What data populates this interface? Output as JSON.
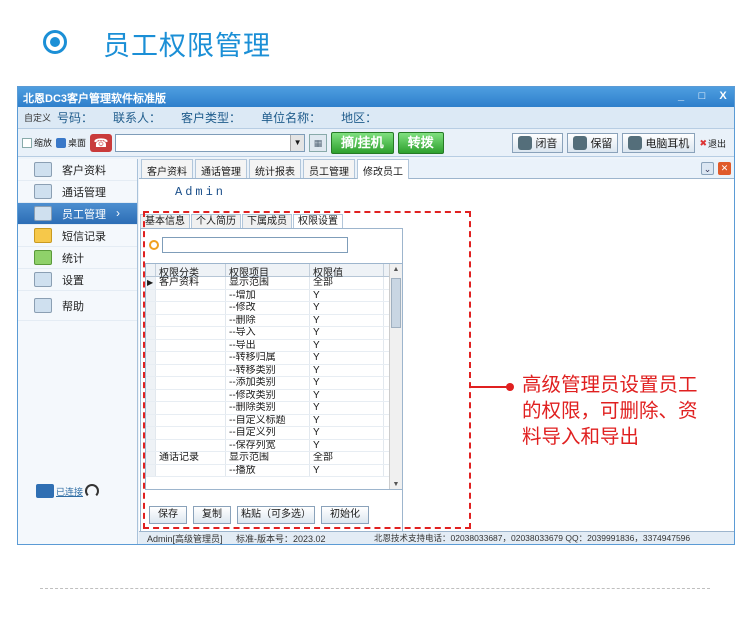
{
  "header": {
    "title": "员工权限管理"
  },
  "window": {
    "title": "北恩DC3客户管理软件标准版",
    "controls": [
      "_",
      "□",
      "X"
    ]
  },
  "infobar": {
    "prefix": "自定义",
    "fields": [
      "号码：",
      "联系人：",
      "客户类型：",
      "单位名称：",
      "地区："
    ]
  },
  "toolbar": {
    "shrink_label": "缩放",
    "desktop_label": "桌面",
    "pickup_label": "摘/挂机",
    "transfer_label": "转拨",
    "mute_label": "闭音",
    "hold_label": "保留",
    "headset_label": "电脑耳机",
    "exit_label": "退出"
  },
  "sidebar": {
    "items": [
      {
        "label": "客户资料",
        "icon": "customer-icon"
      },
      {
        "label": "通话管理",
        "icon": "call-icon"
      },
      {
        "label": "员工管理",
        "icon": "staff-icon",
        "active": true
      },
      {
        "label": "短信记录",
        "icon": "sms-icon"
      },
      {
        "label": "统计",
        "icon": "stats-icon"
      },
      {
        "label": "设置",
        "icon": "settings-icon"
      },
      {
        "label": "帮助",
        "icon": "help-icon"
      }
    ],
    "connect_label": "已连接"
  },
  "tabs": [
    "客户资料",
    "通话管理",
    "统计报表",
    "员工管理",
    "修改员工"
  ],
  "admin_name": "Admin",
  "sub_tabs": [
    "基本信息",
    "个人简历",
    "下属成员",
    "权限设置"
  ],
  "grid": {
    "headers": [
      "权限分类",
      "权限项目",
      "权限值"
    ],
    "rows": [
      [
        "▶",
        "客户资料",
        "显示范围",
        "全部"
      ],
      [
        "",
        "",
        "--增加",
        "Y"
      ],
      [
        "",
        "",
        "--修改",
        "Y"
      ],
      [
        "",
        "",
        "--删除",
        "Y"
      ],
      [
        "",
        "",
        "--导入",
        "Y"
      ],
      [
        "",
        "",
        "--导出",
        "Y"
      ],
      [
        "",
        "",
        "--转移归属",
        "Y"
      ],
      [
        "",
        "",
        "--转移类别",
        "Y"
      ],
      [
        "",
        "",
        "--添加类别",
        "Y"
      ],
      [
        "",
        "",
        "--修改类别",
        "Y"
      ],
      [
        "",
        "",
        "--删除类别",
        "Y"
      ],
      [
        "",
        "",
        "--自定义标题",
        "Y"
      ],
      [
        "",
        "",
        "--自定义列",
        "Y"
      ],
      [
        "",
        "",
        "--保存列宽",
        "Y"
      ],
      [
        "",
        "通话记录",
        "显示范围",
        "全部"
      ],
      [
        "",
        "",
        "--播放",
        "Y"
      ]
    ]
  },
  "buttons": {
    "save": "保存",
    "copy": "复制",
    "paste": "粘贴（可多选）",
    "init": "初始化"
  },
  "status": {
    "user": "Admin[高级管理员]",
    "version": "标准-版本号：2023.02",
    "support": "北恩技术支持电话：02038033687，02038033679 QQ：2039991836，3374947596"
  },
  "callout": "高级管理员设置员工的权限，可删除、资料导入和导出",
  "colors": {
    "accent": "#1b8fd6",
    "annotation": "#e02020",
    "titlebar": "#2e7fcb"
  }
}
